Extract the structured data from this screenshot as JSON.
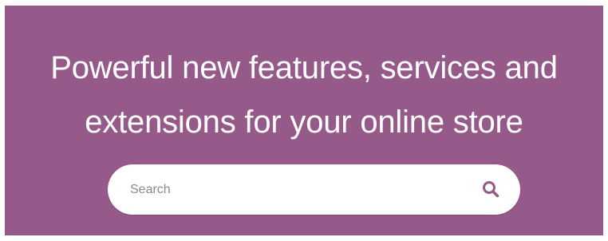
{
  "hero": {
    "background_color": "#955a89",
    "headline_line1": "Powerful new features, services and",
    "headline_line2": "extensions for your online store"
  },
  "search": {
    "placeholder": "Search",
    "value": "",
    "icon": "search-icon",
    "icon_color": "#955a89"
  }
}
